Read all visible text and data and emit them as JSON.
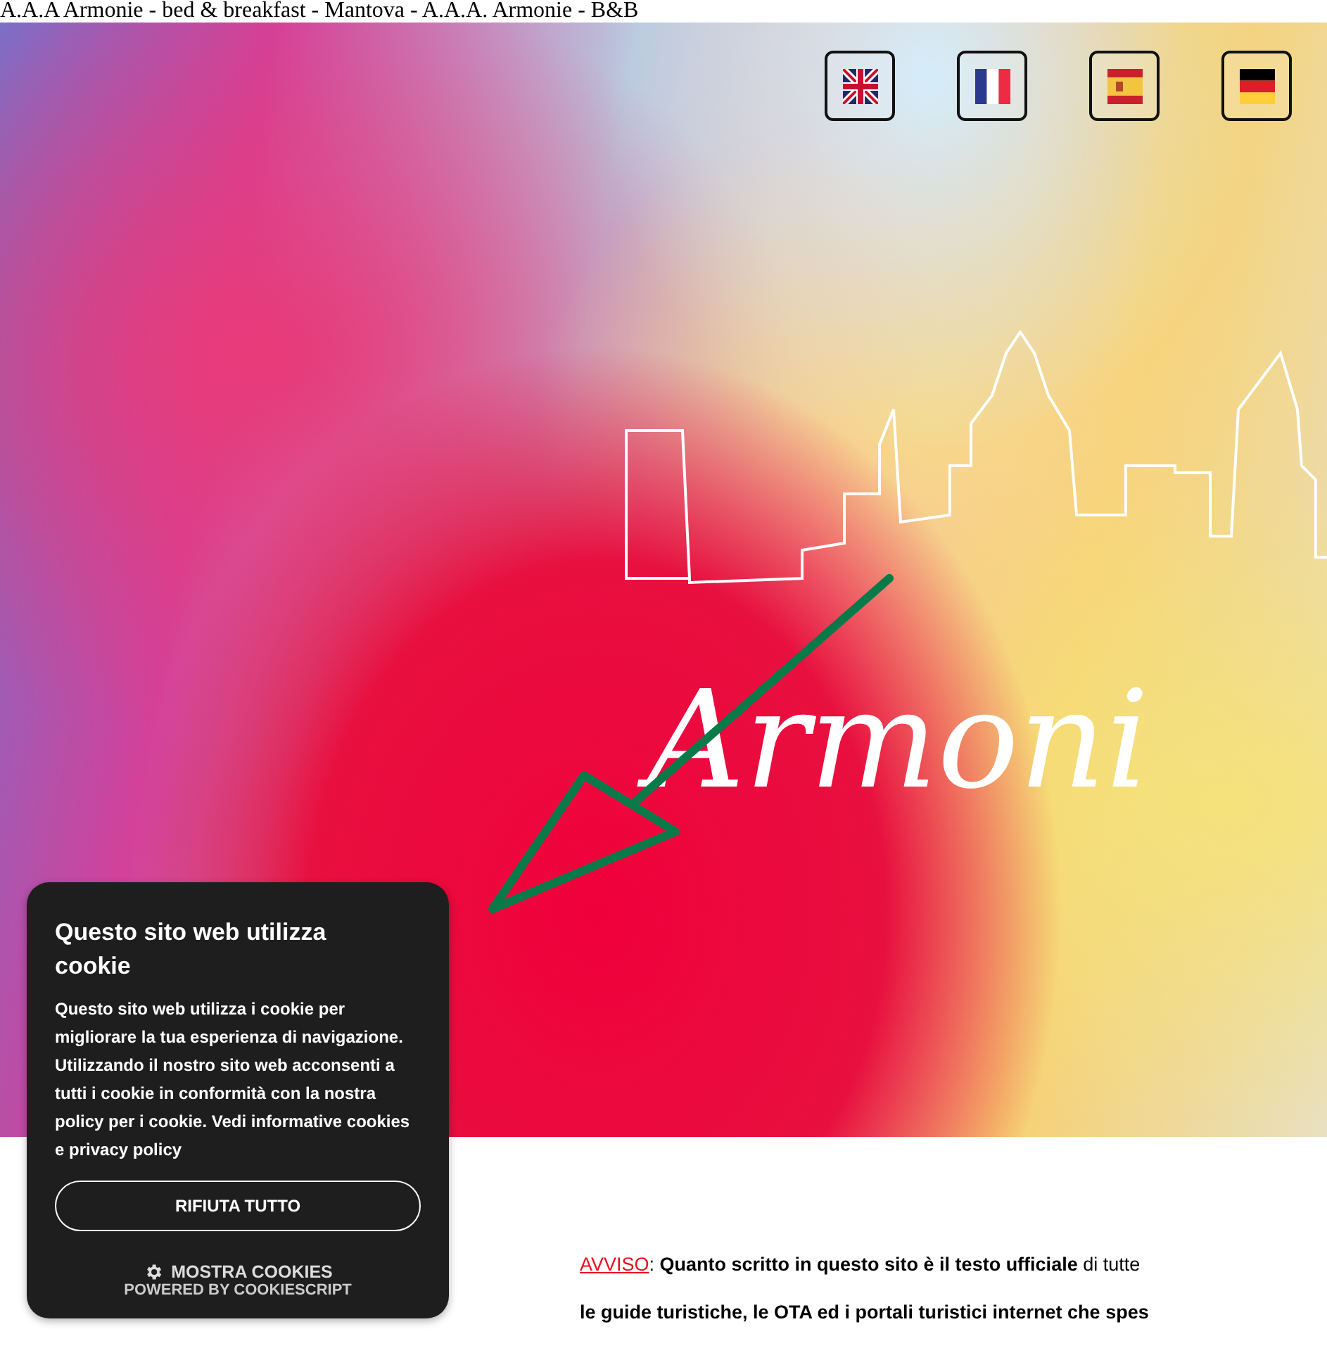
{
  "page_title": "A.A.A Armonie - bed & breakfast - Mantova - A.A.A. Armonie - B&B",
  "flags": [
    {
      "kind": "uk"
    },
    {
      "kind": "fr"
    },
    {
      "kind": "es"
    },
    {
      "kind": "de"
    }
  ],
  "logo_text": "Armoni",
  "notice": {
    "link": "AVVISO",
    "line_1": ": **Quanto scritto in questo sito è il testo ufficiale** di tutte",
    "line_2": "le guide turistiche, le OTA ed i portali turistici internet che spes"
  },
  "cookie_dialog": {
    "title": "Questo sito web utilizza cookie",
    "body": "Questo sito web utilizza i cookie per migliorare la tua esperienza di navigazione. Utilizzando il nostro sito web acconsenti a tutti i cookie in conformità con la nostra policy per i cookie. Vedi informative cookies e privacy policy",
    "reject_button": "RIFIUTA TUTTO",
    "show_cookies": "MOSTRA COOKIES",
    "powered_by": "POWERED BY COOKIESCRIPT"
  }
}
